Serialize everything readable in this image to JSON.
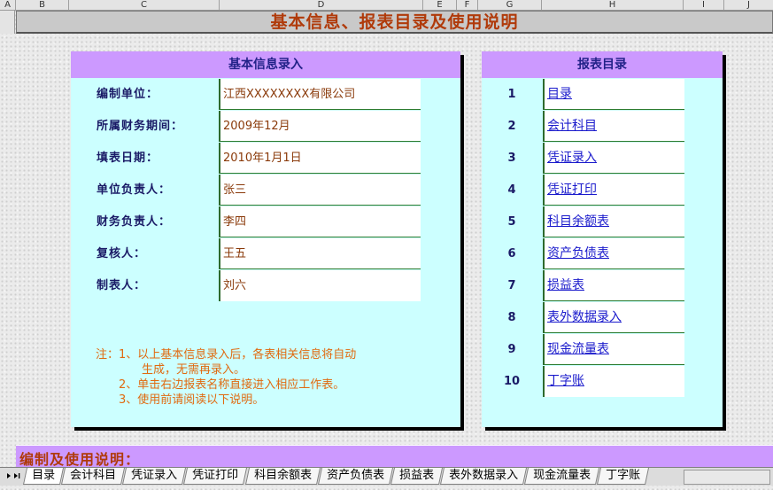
{
  "columns": [
    "A",
    "B",
    "C",
    "D",
    "E",
    "F",
    "G",
    "H",
    "I",
    "J"
  ],
  "title": "基本信息、报表目录及使用说明",
  "info_panel": {
    "heading": "基本信息录入",
    "fields": [
      {
        "label": "编制单位：",
        "value": "江西XXXXXXXX有限公司"
      },
      {
        "label": "所属财务期间：",
        "value": "2009年12月"
      },
      {
        "label": "填表日期：",
        "value": "2010年1月1日"
      },
      {
        "label": "单位负责人：",
        "value": "张三"
      },
      {
        "label": "财务负责人：",
        "value": "李四"
      },
      {
        "label": "复核人：",
        "value": "王五"
      },
      {
        "label": "制表人：",
        "value": "刘六"
      }
    ],
    "notes": [
      "注：1、以上基本信息录入后，各表相关信息将自动",
      "　　　　生成，无需再录入。",
      "　　2、单击右边报表名称直接进入相应工作表。",
      "　　3、使用前请阅读以下说明。"
    ]
  },
  "catalog_panel": {
    "heading": "报表目录",
    "items": [
      {
        "num": "1",
        "name": "目录"
      },
      {
        "num": "2",
        "name": "会计科目"
      },
      {
        "num": "3",
        "name": "凭证录入"
      },
      {
        "num": "4",
        "name": "凭证打印"
      },
      {
        "num": "5",
        "name": "科目余额表"
      },
      {
        "num": "6",
        "name": "资产负债表"
      },
      {
        "num": "7",
        "name": "损益表"
      },
      {
        "num": "8",
        "name": "表外数据录入"
      },
      {
        "num": "9",
        "name": "现金流量表"
      },
      {
        "num": "10",
        "name": "丁字账"
      }
    ]
  },
  "bottom_heading": "编制及使用说明：",
  "sheet_tabs": [
    "目录",
    "会计科目",
    "凭证录入",
    "凭证打印",
    "科目余额表",
    "资产负债表",
    "损益表",
    "表外数据录入",
    "现金流量表",
    "丁字账"
  ],
  "nav_glyphs": "►  ►|"
}
